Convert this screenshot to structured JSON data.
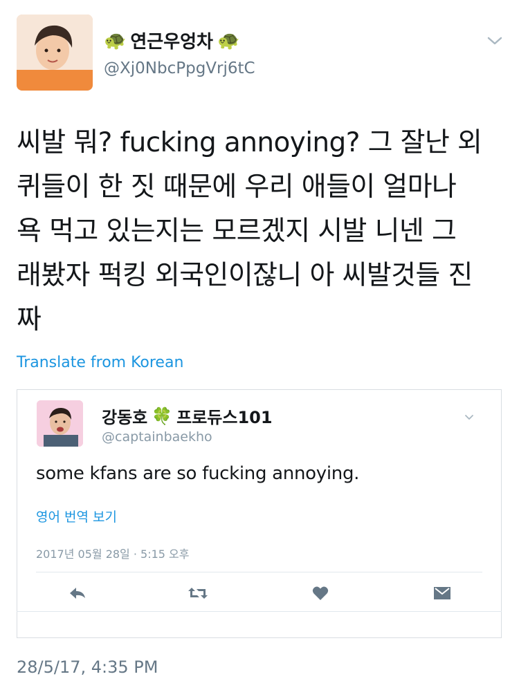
{
  "author": {
    "display_name": "연근우엉차",
    "emoji_left": "🐢",
    "emoji_right": "🐢",
    "handle": "@Xj0NbcPpgVrj6tC"
  },
  "tweet": {
    "lines": [
      "씨발 뭐? fucking annoying? 그 잘난 외",
      "퀴들이 한 짓 때문에 우리 애들이 얼마나",
      "욕 먹고 있는지는 모르겠지 시발 니넨 그",
      "래봤자 퍽킹 외국인이잖니 아 씨발것들 진",
      "짜"
    ],
    "translate_label": "Translate from Korean",
    "timestamp": "28/5/17, 4:35 PM"
  },
  "quoted": {
    "display_name_pre": "강동호",
    "emoji": "🍀",
    "display_name_post": "프로듀스101",
    "handle": "@captainbaekho",
    "text": "some kfans are so fucking annoying.",
    "translate_label": "영어 번역 보기",
    "time": "2017년 05월 28일 · 5:15 오후"
  },
  "icons": {
    "reply": "reply-icon",
    "retweet": "retweet-icon",
    "like": "heart-icon",
    "dm": "envelope-icon",
    "caret": "chevron-down-icon"
  },
  "colors": {
    "link": "#1b95e0",
    "secondary": "#657786",
    "icon": "#657786"
  }
}
